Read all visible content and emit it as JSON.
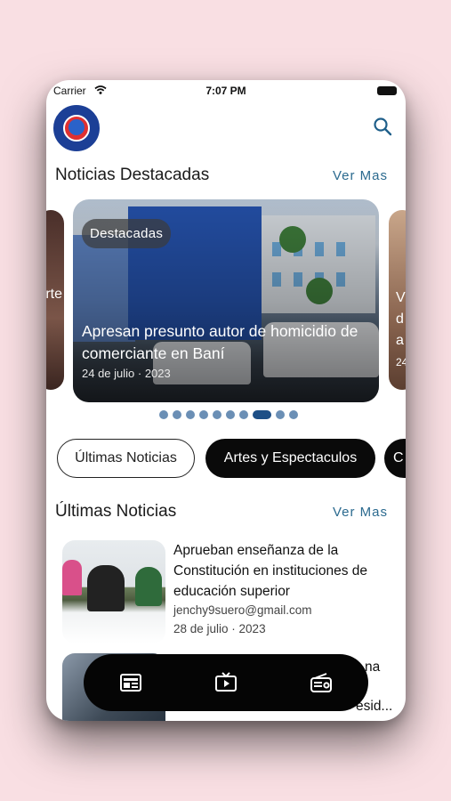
{
  "status": {
    "carrier": "Carrier",
    "time": "7:07 PM"
  },
  "header": {
    "logo_icon": "panorama-logo-icon",
    "search_icon": "search-icon"
  },
  "featured": {
    "title": "Noticias Destacadas",
    "more": "Ver Mas",
    "main": {
      "badge": "Destacadas",
      "headline": "Apresan presunto autor de homicidio de comerciante en Baní",
      "date": "24 de julio · 2023"
    },
    "left_peek": "rte",
    "right_peek": [
      "V",
      "d",
      "a",
      "24"
    ],
    "dots_count": 10,
    "active_dot": 7
  },
  "categories": [
    {
      "label": "Últimas Noticias",
      "selected": false
    },
    {
      "label": "Artes y Espectaculos",
      "selected": true
    },
    {
      "label": "C",
      "selected": true
    }
  ],
  "latest": {
    "title": "Últimas Noticias",
    "more": "Ver Mas",
    "items": [
      {
        "title": "Aprueban enseñanza de la Constitución en instituciones de educación superior",
        "author": "jenchy9suero@gmail.com",
        "date": "28 de julio · 2023"
      },
      {
        "title": "na",
        "subtitle": "esid..."
      }
    ]
  },
  "tabbar": {
    "tabs": [
      "news-icon",
      "tv-icon",
      "radio-icon"
    ]
  },
  "colors": {
    "accent": "#2b6a8f",
    "dot": "#6b8fb5",
    "dot_active": "#1d4f86",
    "background": "#f9dfe3"
  }
}
